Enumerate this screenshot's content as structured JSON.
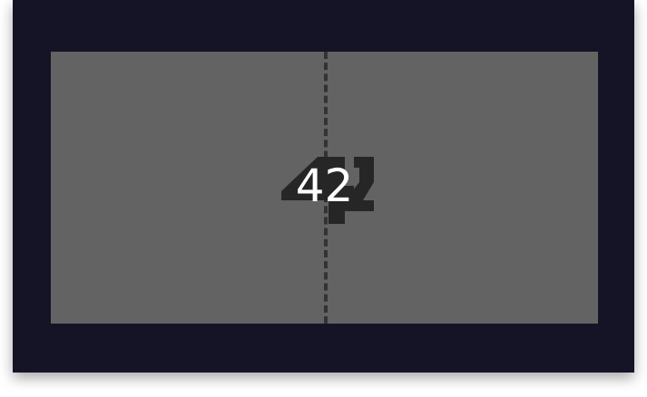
{
  "game": {
    "score": "42"
  },
  "colors": {
    "frame": "#141426",
    "court": "#636363",
    "net": "#333333",
    "score_text": "#ffffff",
    "score_shadow": "#262626"
  }
}
